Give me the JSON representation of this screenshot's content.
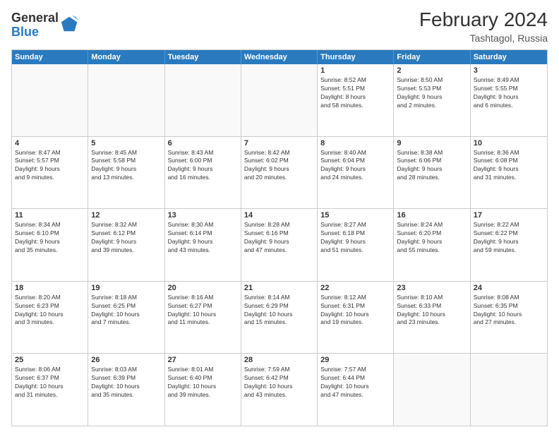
{
  "header": {
    "logo": {
      "general": "General",
      "blue": "Blue"
    },
    "title": "February 2024",
    "location": "Tashtagol, Russia"
  },
  "days_of_week": [
    "Sunday",
    "Monday",
    "Tuesday",
    "Wednesday",
    "Thursday",
    "Friday",
    "Saturday"
  ],
  "weeks": [
    [
      {
        "day": "",
        "info": ""
      },
      {
        "day": "",
        "info": ""
      },
      {
        "day": "",
        "info": ""
      },
      {
        "day": "",
        "info": ""
      },
      {
        "day": "1",
        "info": "Sunrise: 8:52 AM\nSunset: 5:51 PM\nDaylight: 8 hours\nand 58 minutes."
      },
      {
        "day": "2",
        "info": "Sunrise: 8:50 AM\nSunset: 5:53 PM\nDaylight: 9 hours\nand 2 minutes."
      },
      {
        "day": "3",
        "info": "Sunrise: 8:49 AM\nSunset: 5:55 PM\nDaylight: 9 hours\nand 6 minutes."
      }
    ],
    [
      {
        "day": "4",
        "info": "Sunrise: 8:47 AM\nSunset: 5:57 PM\nDaylight: 9 hours\nand 9 minutes."
      },
      {
        "day": "5",
        "info": "Sunrise: 8:45 AM\nSunset: 5:58 PM\nDaylight: 9 hours\nand 13 minutes."
      },
      {
        "day": "6",
        "info": "Sunrise: 8:43 AM\nSunset: 6:00 PM\nDaylight: 9 hours\nand 16 minutes."
      },
      {
        "day": "7",
        "info": "Sunrise: 8:42 AM\nSunset: 6:02 PM\nDaylight: 9 hours\nand 20 minutes."
      },
      {
        "day": "8",
        "info": "Sunrise: 8:40 AM\nSunset: 6:04 PM\nDaylight: 9 hours\nand 24 minutes."
      },
      {
        "day": "9",
        "info": "Sunrise: 8:38 AM\nSunset: 6:06 PM\nDaylight: 9 hours\nand 28 minutes."
      },
      {
        "day": "10",
        "info": "Sunrise: 8:36 AM\nSunset: 6:08 PM\nDaylight: 9 hours\nand 31 minutes."
      }
    ],
    [
      {
        "day": "11",
        "info": "Sunrise: 8:34 AM\nSunset: 6:10 PM\nDaylight: 9 hours\nand 35 minutes."
      },
      {
        "day": "12",
        "info": "Sunrise: 8:32 AM\nSunset: 6:12 PM\nDaylight: 9 hours\nand 39 minutes."
      },
      {
        "day": "13",
        "info": "Sunrise: 8:30 AM\nSunset: 6:14 PM\nDaylight: 9 hours\nand 43 minutes."
      },
      {
        "day": "14",
        "info": "Sunrise: 8:28 AM\nSunset: 6:16 PM\nDaylight: 9 hours\nand 47 minutes."
      },
      {
        "day": "15",
        "info": "Sunrise: 8:27 AM\nSunset: 6:18 PM\nDaylight: 9 hours\nand 51 minutes."
      },
      {
        "day": "16",
        "info": "Sunrise: 8:24 AM\nSunset: 6:20 PM\nDaylight: 9 hours\nand 55 minutes."
      },
      {
        "day": "17",
        "info": "Sunrise: 8:22 AM\nSunset: 6:22 PM\nDaylight: 9 hours\nand 59 minutes."
      }
    ],
    [
      {
        "day": "18",
        "info": "Sunrise: 8:20 AM\nSunset: 6:23 PM\nDaylight: 10 hours\nand 3 minutes."
      },
      {
        "day": "19",
        "info": "Sunrise: 8:18 AM\nSunset: 6:25 PM\nDaylight: 10 hours\nand 7 minutes."
      },
      {
        "day": "20",
        "info": "Sunrise: 8:16 AM\nSunset: 6:27 PM\nDaylight: 10 hours\nand 11 minutes."
      },
      {
        "day": "21",
        "info": "Sunrise: 8:14 AM\nSunset: 6:29 PM\nDaylight: 10 hours\nand 15 minutes."
      },
      {
        "day": "22",
        "info": "Sunrise: 8:12 AM\nSunset: 6:31 PM\nDaylight: 10 hours\nand 19 minutes."
      },
      {
        "day": "23",
        "info": "Sunrise: 8:10 AM\nSunset: 6:33 PM\nDaylight: 10 hours\nand 23 minutes."
      },
      {
        "day": "24",
        "info": "Sunrise: 8:08 AM\nSunset: 6:35 PM\nDaylight: 10 hours\nand 27 minutes."
      }
    ],
    [
      {
        "day": "25",
        "info": "Sunrise: 8:06 AM\nSunset: 6:37 PM\nDaylight: 10 hours\nand 31 minutes."
      },
      {
        "day": "26",
        "info": "Sunrise: 8:03 AM\nSunset: 6:39 PM\nDaylight: 10 hours\nand 35 minutes."
      },
      {
        "day": "27",
        "info": "Sunrise: 8:01 AM\nSunset: 6:40 PM\nDaylight: 10 hours\nand 39 minutes."
      },
      {
        "day": "28",
        "info": "Sunrise: 7:59 AM\nSunset: 6:42 PM\nDaylight: 10 hours\nand 43 minutes."
      },
      {
        "day": "29",
        "info": "Sunrise: 7:57 AM\nSunset: 6:44 PM\nDaylight: 10 hours\nand 47 minutes."
      },
      {
        "day": "",
        "info": ""
      },
      {
        "day": "",
        "info": ""
      }
    ]
  ]
}
